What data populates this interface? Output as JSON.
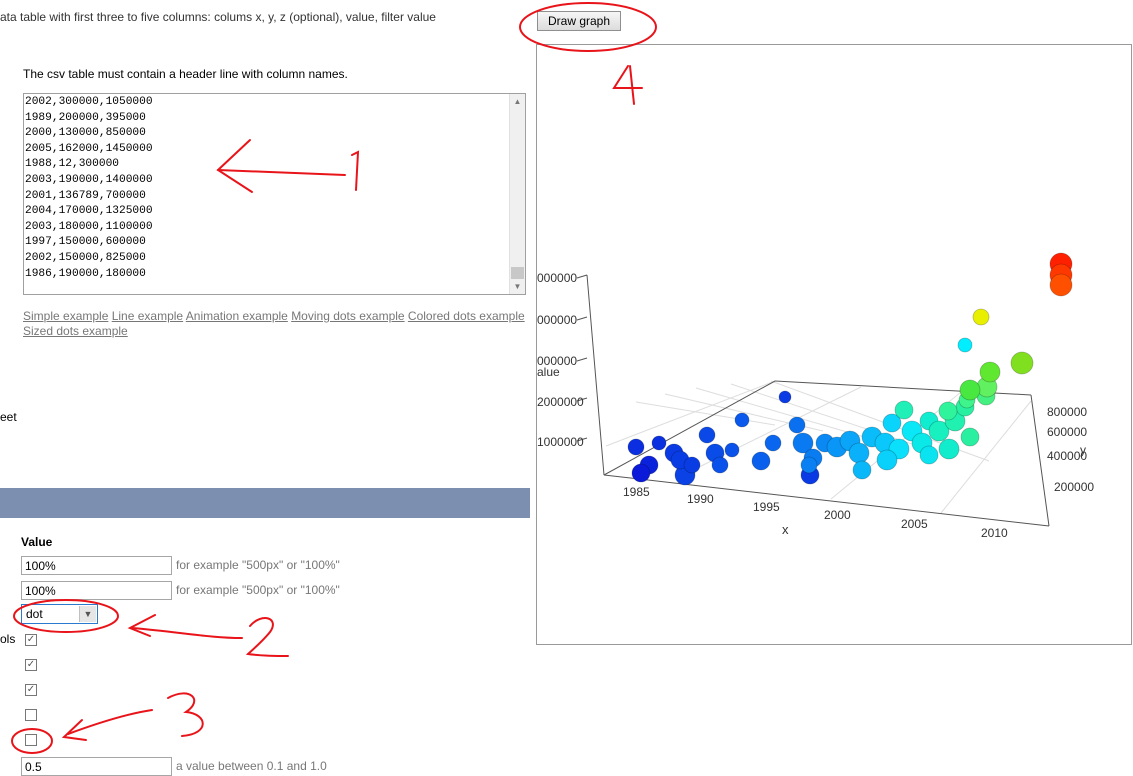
{
  "intro": {
    "clipped_text": "ata table with first three to five columns: colums x, y, z (optional), value, filter value",
    "header_note": "The csv table must contain a header line with column names."
  },
  "csv": {
    "lines": [
      "2002,300000,1050000",
      "1989,200000,395000",
      "2000,130000,850000",
      "2005,162000,1450000",
      "1988,12,300000",
      "2003,190000,1400000",
      "2001,136789,700000",
      "2004,170000,1325000",
      "2003,180000,1100000",
      "1997,150000,600000",
      "2002,150000,825000",
      "1986,190000,180000"
    ]
  },
  "examples": {
    "simple": "Simple example",
    "line": "Line example",
    "animation": "Animation example",
    "moving": "Moving dots example",
    "colored": "Colored dots example",
    "sized": "Sized dots example"
  },
  "left_labels": {
    "sheet": "eet",
    "ols": "ols"
  },
  "settings": {
    "heading": "Value",
    "width": {
      "value": "100%",
      "hint": "for example \"500px\" or \"100%\""
    },
    "height": {
      "value": "100%",
      "hint": "for example \"500px\" or \"100%\""
    },
    "style_select": {
      "value": "dot"
    },
    "checkboxes": [
      {
        "checked": true
      },
      {
        "checked": true
      },
      {
        "checked": true
      },
      {
        "checked": false
      },
      {
        "checked": false
      }
    ],
    "opacity": {
      "value": "0.5",
      "hint": "a value between 0.1 and 1.0"
    }
  },
  "draw_button": "Draw graph",
  "annotations": [
    "1",
    "2",
    "3",
    "4"
  ],
  "colors": {
    "annotation": "#e8141a",
    "header_bar": "#7d8fb0",
    "link": "#777777"
  },
  "graph": {
    "zlabels": [
      "000000",
      "000000",
      "000000",
      "2000000",
      "1000000"
    ],
    "zaxis_title": "alue",
    "xlabels": [
      "1985",
      "1990",
      "1995",
      "2000",
      "2005",
      "2010"
    ],
    "xaxis_title": "x",
    "ylabels": [
      "800000",
      "600000",
      "400000",
      "200000"
    ],
    "yaxis_title": "y"
  }
}
